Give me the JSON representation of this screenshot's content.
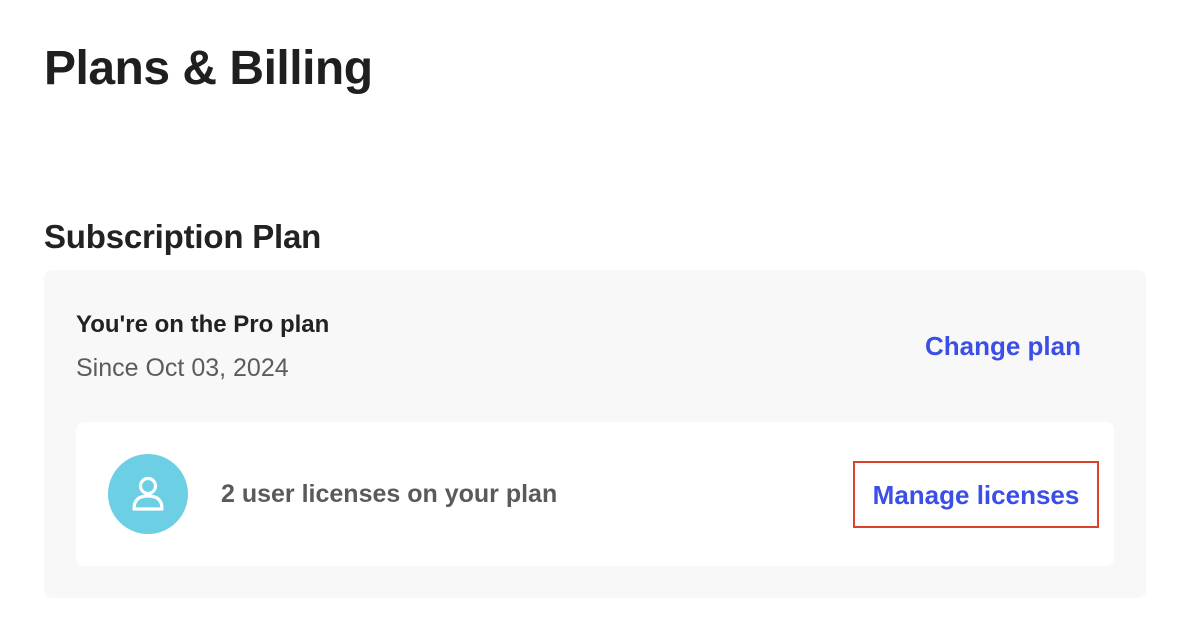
{
  "page": {
    "title": "Plans & Billing"
  },
  "subscription": {
    "section_title": "Subscription Plan",
    "plan_name": "You're on the Pro plan",
    "since": "Since Oct 03, 2024",
    "change_plan_label": "Change plan"
  },
  "licenses": {
    "summary": "2 user licenses on your plan",
    "manage_label": "Manage licenses",
    "avatar_icon": "user-icon",
    "avatar_color": "#6ccfe3",
    "highlight_color": "#d9432b"
  },
  "colors": {
    "link": "#3b4ee6",
    "card_background": "#f8f8f8"
  }
}
